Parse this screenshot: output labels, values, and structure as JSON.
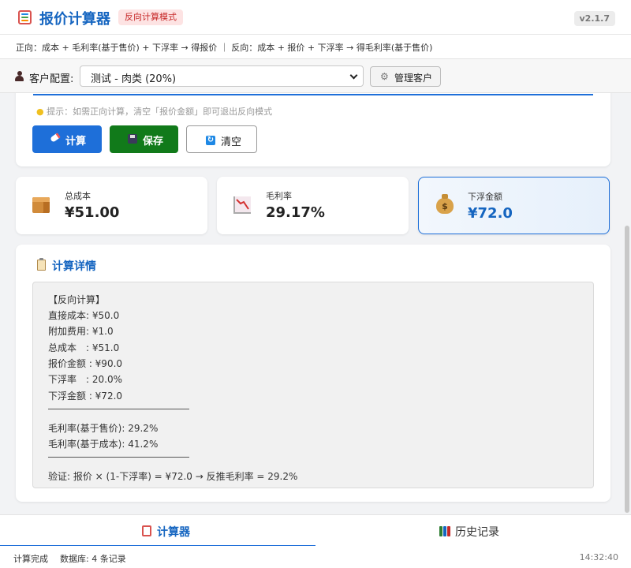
{
  "header": {
    "title": "报价计算器",
    "mode_badge": "反向计算模式",
    "version": "v2.1.7"
  },
  "formula_hint": "正向：成本 + 毛利率(基于售价) + 下浮率 → 得报价 ｜ 反向：成本 + 报价 + 下浮率 → 得毛利率(基于售价)",
  "client": {
    "label": "客户配置:",
    "selected": "测试 - 肉类 (20%)",
    "manage_button": "管理客户"
  },
  "form": {
    "tip": "提示：如需正向计算，清空「报价金额」即可退出反向模式",
    "calc_button": "计算",
    "save_button": "保存",
    "clear_button": "清空"
  },
  "stats": [
    {
      "label": "总成本",
      "value": "¥51.00",
      "icon": "package-icon"
    },
    {
      "label": "毛利率",
      "value": "29.17%",
      "icon": "chart-decreasing-icon"
    },
    {
      "label": "下浮金额",
      "value": "¥72.0",
      "icon": "money-bag-icon"
    }
  ],
  "details": {
    "title": "计算详情",
    "lines": [
      "【反向计算】",
      "直接成本: ¥50.0",
      "附加费用: ¥1.0",
      "总成本　: ¥51.0",
      "报价金额 : ¥90.0",
      "下浮率　: 20.0%",
      "下浮金额 : ¥72.0",
      "毛利率(基于售价): 29.2%",
      "毛利率(基于成本): 41.2%",
      "验证: 报价 × (1-下浮率) = ¥72.0 → 反推毛利率 = 29.2%"
    ]
  },
  "tabs": [
    {
      "label": "计算器",
      "active": true
    },
    {
      "label": "历史记录",
      "active": false
    }
  ],
  "status": {
    "message": "计算完成",
    "db": "数据库: 4 条记录",
    "time": "14:32:40"
  },
  "colors": {
    "primary": "#1e6fd9",
    "save_green": "#117a1a",
    "title_blue": "#1565c0",
    "badge_red": "#c62828"
  }
}
